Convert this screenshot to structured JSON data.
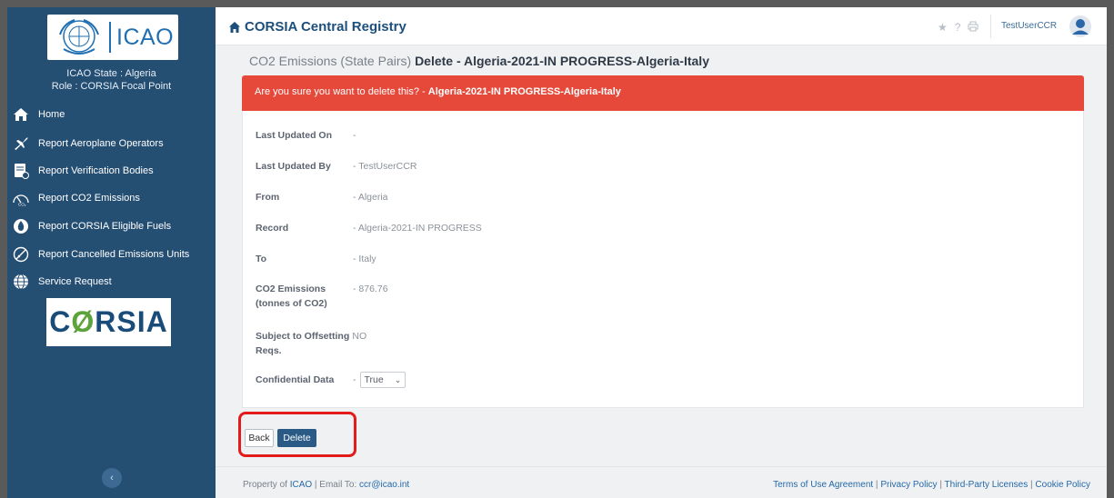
{
  "sidebar": {
    "logo_text": "ICAO",
    "state": "ICAO State : Algeria",
    "role": "Role : CORSIA Focal Point",
    "items": [
      {
        "label": "Home",
        "icon": "home-icon"
      },
      {
        "label": "Report Aeroplane Operators",
        "icon": "airplane-icon"
      },
      {
        "label": "Report Verification Bodies",
        "icon": "document-icon"
      },
      {
        "label": "Report CO2 Emissions",
        "icon": "co2-gauge-icon"
      },
      {
        "label": "Report CORSIA Eligible Fuels",
        "icon": "fuel-drop-icon"
      },
      {
        "label": "Report Cancelled Emissions Units",
        "icon": "cancelled-icon"
      },
      {
        "label": "Service Request",
        "icon": "globe-icon"
      }
    ],
    "corsia_logo": {
      "part1": "C",
      "part2": "Ø",
      "part3": "RSIA"
    },
    "collapse_icon": "chevron-left-icon"
  },
  "topbar": {
    "brand": "CORSIA Central Registry",
    "icons": [
      "star-icon",
      "help-icon",
      "print-icon"
    ],
    "help_glyph": "?",
    "user": "TestUserCCR"
  },
  "heading": {
    "section": "CO2 Emissions (State Pairs)",
    "title": "Delete - Algeria-2021-IN PROGRESS-Algeria-Italy"
  },
  "alert": {
    "prefix": "Are you sure you want to delete this? - ",
    "record": "Algeria-2021-IN PROGRESS-Algeria-Italy"
  },
  "details": [
    {
      "label": "Last Updated On",
      "value": "-"
    },
    {
      "label": "Last Updated By",
      "value": "- TestUserCCR"
    },
    {
      "label": "From",
      "value": "- Algeria"
    },
    {
      "label": "Record",
      "value": "- Algeria-2021-IN PROGRESS"
    },
    {
      "label": "To",
      "value": "- Italy"
    },
    {
      "label": "CO2 Emissions (tonnes of CO2)",
      "value": "- 876.76"
    },
    {
      "label": "Subject to Offsetting Reqs.",
      "value": "- NO"
    },
    {
      "label": "Confidential Data",
      "value": "-"
    }
  ],
  "confidential_select": {
    "value": "True"
  },
  "buttons": {
    "back": "Back",
    "delete": "Delete"
  },
  "footer": {
    "property_prefix": "Property of ",
    "icao_link": "ICAO",
    "email_prefix": " | Email To: ",
    "email": "ccr@icao.int",
    "links": [
      "Terms of Use Agreement",
      "Privacy Policy",
      "Third-Party Licenses",
      "Cookie Policy"
    ],
    "separator": " | "
  }
}
